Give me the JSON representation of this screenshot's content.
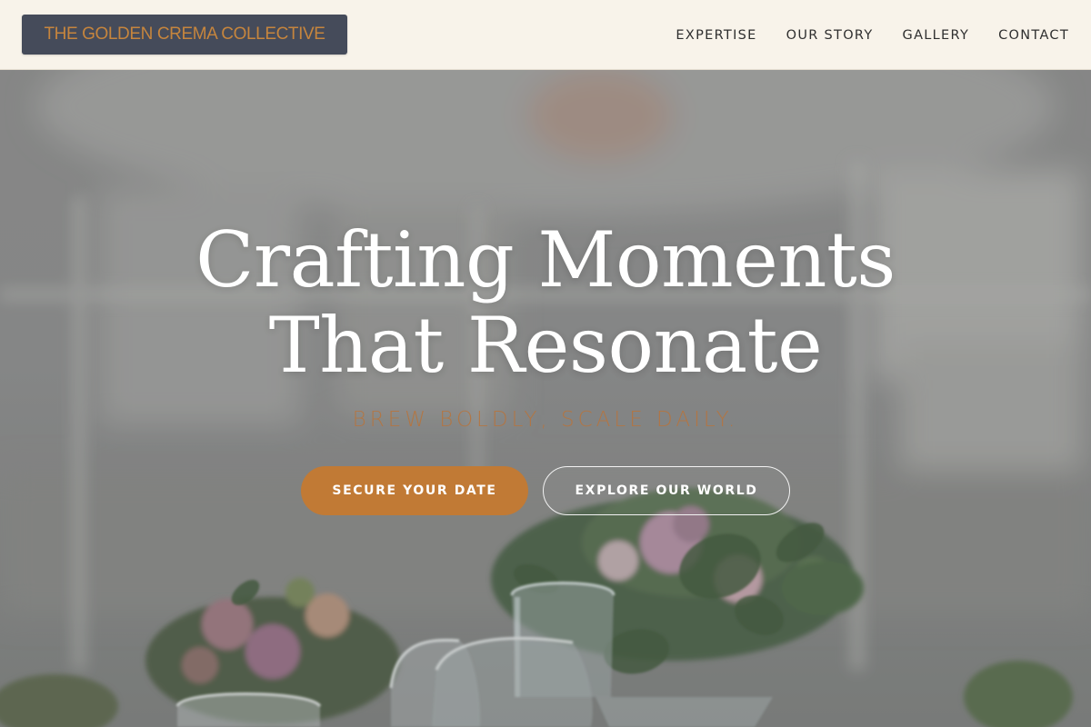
{
  "brand": {
    "name": "THE GOLDEN CREMA COLLECTIVE"
  },
  "nav": {
    "items": [
      "EXPERTISE",
      "OUR STORY",
      "GALLERY",
      "CONTACT"
    ]
  },
  "hero": {
    "headline_line1": "Crafting Moments",
    "headline_line2": "That Resonate",
    "tagline": "BREW BOLDLY, SCALE DAILY.",
    "primary_cta": "SECURE YOUR DATE",
    "secondary_cta": "EXPLORE OUR WORLD",
    "background_image": "blurred-wedding-table-with-flowers-and-glasses"
  },
  "colors": {
    "accent": "#c17a35",
    "logo_background": "#454b5a",
    "header_background": "#f8f3ea"
  }
}
